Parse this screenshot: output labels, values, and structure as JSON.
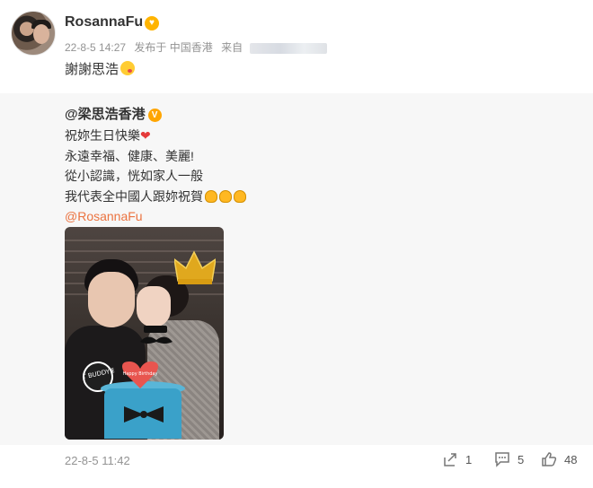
{
  "post": {
    "username": "RosannaFu",
    "time": "22-8-5 14:27",
    "location": "发布于 中国香港",
    "source_prefix": "来自",
    "text": "謝謝思浩"
  },
  "retweet": {
    "author": "@梁思浩香港",
    "lines": [
      "祝妳生日快樂",
      "永遠幸福、健康、美麗!",
      "從小認識，恍如家人一般",
      "我代表全中國人跟妳祝賀"
    ],
    "mention": "@RosannaFu",
    "date": "22-8-5 11:42",
    "counts": {
      "reposts": "1",
      "comments": "5",
      "likes": "48"
    },
    "photo_text": [
      "BEST BUDDY EVER",
      "Happy Birthday"
    ]
  },
  "colors": {
    "mention": "#eb7340",
    "gold_v": "#ffa500",
    "heart": "#e53a3a"
  }
}
